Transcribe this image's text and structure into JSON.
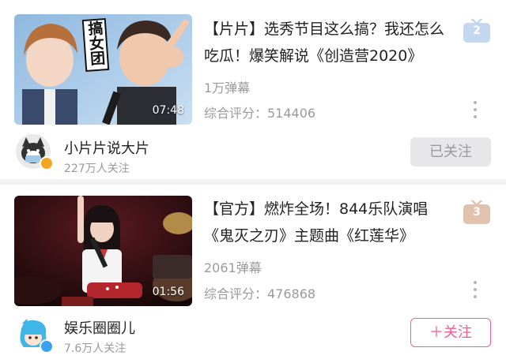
{
  "colors": {
    "accent_pink": "#f45a8d",
    "rank_blue": "#c4d7f1",
    "rank_tan": "#e2c1ad",
    "meta_gray": "#9a9a9a"
  },
  "videos": [
    {
      "title": "【片片】选秀节目这么搞？我还怎么吃瓜！爆笑解说《创造营2020》",
      "duration": "07:48",
      "thumbnail_caption": "搞女团",
      "danmaku": "1万弹幕",
      "score": "综合评分：514406",
      "rank": "2",
      "rank_icon": "tv-rank-icon",
      "uploader": "小片片说大片",
      "followers": "227万人关注",
      "follow_label": "已关注",
      "follow_state": "followed"
    },
    {
      "title": "【官方】燃炸全场！844乐队演唱《鬼灭之刃》主题曲《红莲华》",
      "duration": "01:56",
      "danmaku": "2061弹幕",
      "score": "综合评分：476868",
      "rank": "3",
      "rank_icon": "tv-rank-icon",
      "uploader": "娱乐圈圈儿",
      "followers": "7.6万人关注",
      "follow_label": "＋关注",
      "follow_state": "not-followed"
    }
  ]
}
